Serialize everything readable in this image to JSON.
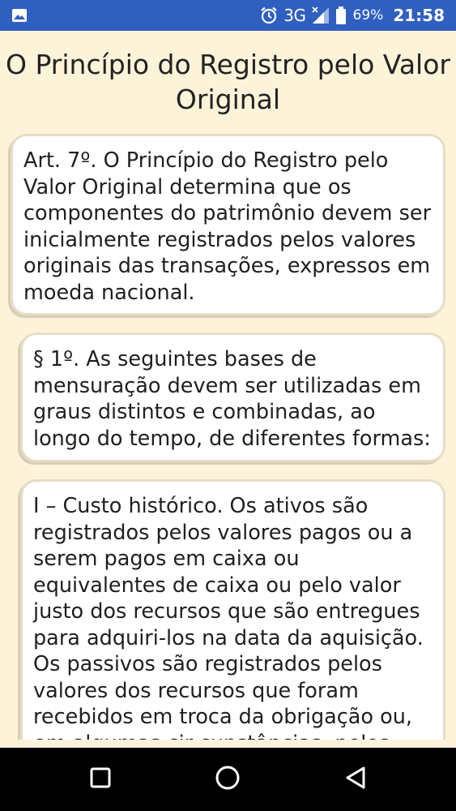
{
  "status_bar": {
    "notification_icon": "gallery-icon",
    "alarm_icon": "alarm-clock-icon",
    "network_type": "3G",
    "signal_icon": "cell-signal-icon",
    "battery_icon": "battery-icon",
    "battery_percent": "69%",
    "time": "21:58",
    "background_color": "#2f5fbf"
  },
  "page": {
    "title": "O Princípio do Registro pelo Valor Original",
    "background_color": "#fdf3d9"
  },
  "cards": [
    {
      "text": "Art. 7º. O Princípio do Registro pelo Valor Original determina que os componentes do patrimônio devem ser inicialmente registrados pelos valores originais das transações, expressos em moeda nacional."
    },
    {
      "text": "§ 1º. As seguintes bases de mensuração devem ser utilizadas em graus distintos e combinadas, ao longo do tempo, de diferentes formas:"
    },
    {
      "text": "I – Custo histórico. Os ativos são registrados pelos valores pagos ou a serem pagos em caixa ou equivalentes de caixa ou pelo valor justo dos recursos que são entregues para adquiri-los na data da aquisição. Os passivos são registrados pelos valores dos recursos que foram recebidos em troca da obrigação ou, em algumas cir-cunstâncias, pelos valores em caixa"
    }
  ],
  "nav_bar": {
    "recents_icon": "square-recents-icon",
    "home_icon": "circle-home-icon",
    "back_icon": "triangle-back-icon"
  }
}
